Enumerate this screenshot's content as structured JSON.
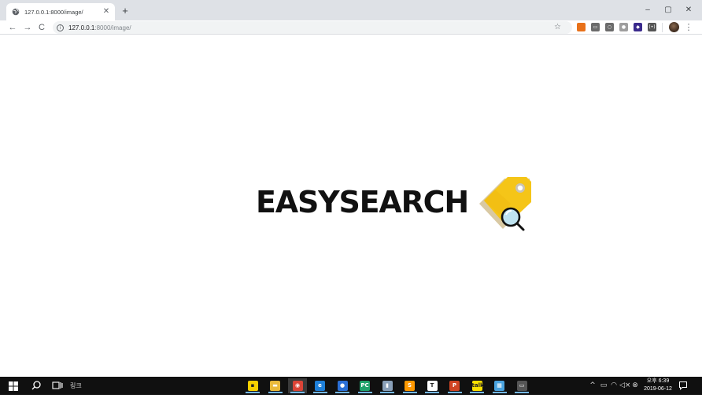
{
  "browser": {
    "tab": {
      "title": "127.0.0.1:8000/image/",
      "close_glyph": "✕",
      "favicon": "globe-icon"
    },
    "new_tab_glyph": "+",
    "window_controls": {
      "minimize": "–",
      "maximize": "▢",
      "close": "✕"
    },
    "nav": {
      "back": "←",
      "forward": "→",
      "reload": "C"
    },
    "address": {
      "host": "127.0.0.1",
      "path": ":8000/image/",
      "info_glyph": "i"
    },
    "bookmark_glyph": "☆",
    "extensions": [
      {
        "icon": "extension-orange-icon",
        "label": "",
        "color": "#e8711a"
      },
      {
        "icon": "extension-card-icon",
        "label": "▭",
        "color": "#6b6b6b"
      },
      {
        "icon": "extension-circle-icon",
        "label": "○",
        "color": "#6b6b6b"
      },
      {
        "icon": "extension-gray-icon",
        "label": "●",
        "color": "#9e9e9e"
      },
      {
        "icon": "extension-gem-icon",
        "label": "◆",
        "color": "#3a2a8c"
      },
      {
        "icon": "extension-radio-icon",
        "label": "(•)",
        "color": "#555555"
      }
    ],
    "menu_glyph": "⋮"
  },
  "page": {
    "logo_text": "EASYSEARCH",
    "logo_icon": "tag-magnifier-icon",
    "colors": {
      "tag": "#f5c518",
      "tag_shadow": "#d9c9a3",
      "text": "#111111"
    }
  },
  "taskbar": {
    "search_link_label": "링크",
    "apps": [
      {
        "name": "sticky-notes-icon",
        "glyph": "▪",
        "color": "#f8d000",
        "active": false
      },
      {
        "name": "file-explorer-icon",
        "glyph": "▬",
        "color": "#e9b93a",
        "active": false
      },
      {
        "name": "chrome-icon",
        "glyph": "◉",
        "color": "#db4437",
        "active": true
      },
      {
        "name": "edge-icon",
        "glyph": "e",
        "color": "#1e7fd8",
        "active": false
      },
      {
        "name": "app-blue-circle-icon",
        "glyph": "●",
        "color": "#2b6fd6",
        "active": false
      },
      {
        "name": "pycharm-icon",
        "glyph": "PC",
        "color": "#1fa36b",
        "active": false
      },
      {
        "name": "app-gray-icon",
        "glyph": "▮",
        "color": "#8aa0b8",
        "active": false
      },
      {
        "name": "sublime-icon",
        "glyph": "S",
        "color": "#ff9800",
        "active": false
      },
      {
        "name": "typora-icon",
        "glyph": "T",
        "color": "#ffffff",
        "active": false
      },
      {
        "name": "powerpoint-icon",
        "glyph": "P",
        "color": "#d04423",
        "active": false
      },
      {
        "name": "kakaotalk-icon",
        "glyph": "talk",
        "color": "#fae100",
        "active": false
      },
      {
        "name": "paint-icon",
        "glyph": "▦",
        "color": "#4aa3df",
        "active": false
      },
      {
        "name": "terminal-icon",
        "glyph": "▭",
        "color": "#555555",
        "active": false
      }
    ],
    "tray": {
      "chevron": "^",
      "battery": "▭",
      "wifi": "◠",
      "volume": "◁×",
      "close_circle": "⊗"
    },
    "clock": {
      "time": "오후 6:39",
      "date": "2019-06-12"
    }
  }
}
